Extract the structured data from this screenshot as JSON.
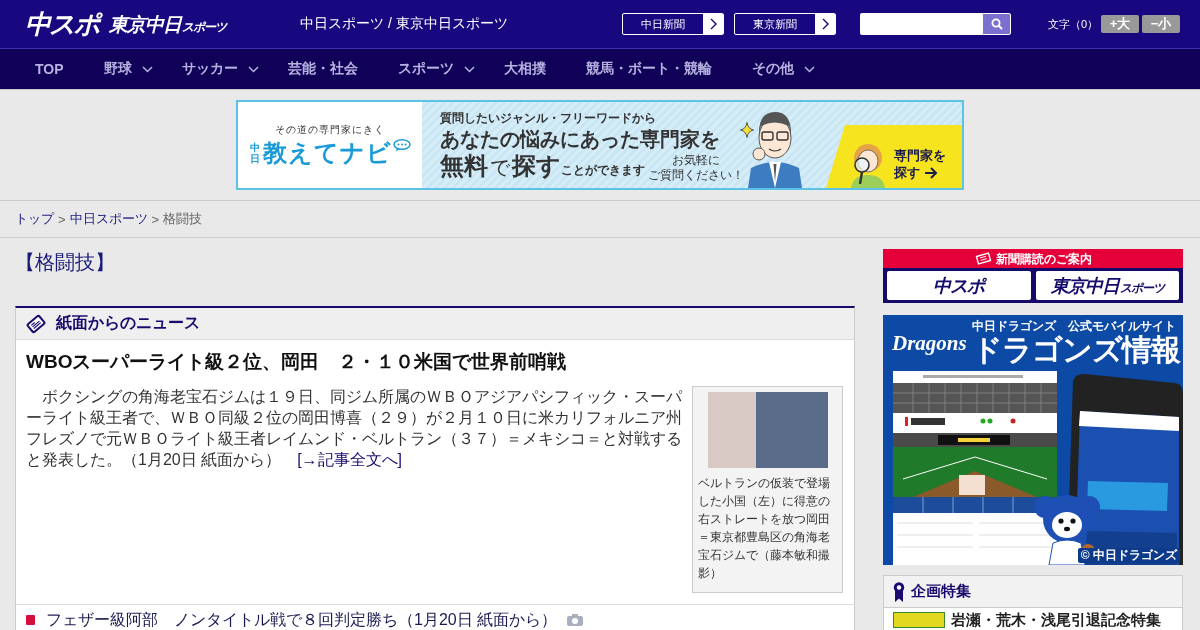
{
  "header": {
    "logos": [
      {
        "main": "中スポ"
      },
      {
        "main": "東京中日",
        "sub": "スポーツ"
      }
    ],
    "tagline": "中日スポーツ / 東京中日スポーツ",
    "paper_links": [
      "中日新聞",
      "東京新聞"
    ],
    "font_size": {
      "label": "文字（0）",
      "buttons": [
        "+大",
        "−小"
      ]
    }
  },
  "nav": [
    {
      "label": "TOP",
      "dropdown": false
    },
    {
      "label": "野球",
      "dropdown": true
    },
    {
      "label": "サッカー",
      "dropdown": true
    },
    {
      "label": "芸能・社会",
      "dropdown": false
    },
    {
      "label": "スポーツ",
      "dropdown": true
    },
    {
      "label": "大相撲",
      "dropdown": false
    },
    {
      "label": "競馬・ボート・競輪",
      "dropdown": false
    },
    {
      "label": "その他",
      "dropdown": true
    }
  ],
  "ad_banner": {
    "kicker": "その道の専門家にきく",
    "brand_prefix": "中日",
    "brand": "教えてナビ",
    "lead": "質問したいジャンル・フリーワードから",
    "headline": "あなたの悩みにあった専門家を",
    "tagline": [
      {
        "text": "無料",
        "kind": "big"
      },
      {
        "text": "で",
        "kind": "thin"
      },
      {
        "text": "探す",
        "kind": "big"
      },
      {
        "text": "ことができます",
        "kind": "small"
      }
    ],
    "note": [
      "お気軽に",
      "ご質問ください！"
    ],
    "cta": [
      "専門家を",
      "探す"
    ]
  },
  "breadcrumb": {
    "separator": ">",
    "items": [
      {
        "label": "トップ",
        "link": true
      },
      {
        "label": "中日スポーツ",
        "link": true
      },
      {
        "label": "格闘技",
        "link": false
      }
    ]
  },
  "page_title": "【格闘技】",
  "news": {
    "title": "紙面からのニュース",
    "lead": {
      "headline": "WBOスーパーライト級２位、岡田　２・１０米国で世界前哨戦",
      "body": "　ボクシングの角海老宝石ジムは１９日、同ジム所属のＷＢＯアジアパシフィック・スーパーライト級王者で、ＷＢＯ同級２位の岡田博喜（２９）が２月１０日に米カリフォルニア州フレズノで元ＷＢＯライト級王者レイムンド・ベルトラン（３７）＝メキシコ＝と対戦すると発表した。（1月20日 紙面から）",
      "more": "[→記事全文へ]",
      "caption": "ベルトランの仮装で登場した小国（左）に得意の右ストレートを放つ岡田＝東京都豊島区の角海老宝石ジムで（藤本敏和撮影）"
    },
    "items": [
      {
        "text": "フェザー級阿部　ノンタイトル戦で８回判定勝ち（1月20日 紙面から）",
        "photo": true
      }
    ]
  },
  "sidebar": {
    "subscription": {
      "title": "新聞購読のご案内",
      "logos": [
        {
          "main": "中スポ"
        },
        {
          "main": "東京中日",
          "sub": "スポーツ"
        }
      ]
    },
    "dragons_ad": {
      "brand": "Dragons",
      "subtitle": "中日ドラゴンズ　公式モバイルサイト",
      "title": "ドラゴンズ情報",
      "copyright": "© 中日ドラゴンズ"
    },
    "features": {
      "title": "企画特集",
      "items": [
        {
          "text": "岩瀬・荒木・浅尾引退記念特集"
        }
      ]
    }
  }
}
